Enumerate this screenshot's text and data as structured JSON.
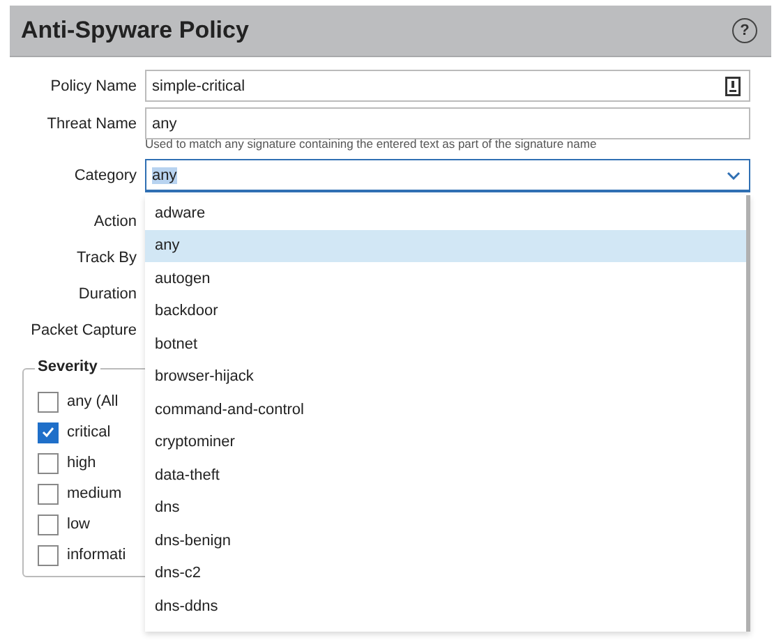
{
  "dialog": {
    "title": "Anti-Spyware Policy",
    "help": "?"
  },
  "fields": [
    {
      "label": "Policy Name",
      "kind": "text",
      "value": "simple-critical"
    },
    {
      "label": "Threat Name",
      "kind": "text",
      "value": "any",
      "hint": "Used to match any signature containing the entered text as part of the signature name"
    },
    {
      "label": "Category",
      "kind": "select",
      "value": "any",
      "focused": true
    }
  ],
  "other_labels": [
    "Action",
    "Track By",
    "Duration",
    "Packet Capture"
  ],
  "severity": {
    "legend": "Severity",
    "options": [
      {
        "label": "any (All",
        "checked": false
      },
      {
        "label": "critical",
        "checked": true
      },
      {
        "label": "high",
        "checked": false
      },
      {
        "label": "medium",
        "checked": false
      },
      {
        "label": "low",
        "checked": false
      },
      {
        "label": "informati",
        "checked": false
      }
    ]
  },
  "dropdown": {
    "items": [
      {
        "label": "adware",
        "selected": false
      },
      {
        "label": "any",
        "selected": true
      },
      {
        "label": "autogen",
        "selected": false
      },
      {
        "label": "backdoor",
        "selected": false
      },
      {
        "label": "botnet",
        "selected": false
      },
      {
        "label": "browser-hijack",
        "selected": false
      },
      {
        "label": "command-and-control",
        "selected": false
      },
      {
        "label": "cryptominer",
        "selected": false
      },
      {
        "label": "data-theft",
        "selected": false
      },
      {
        "label": "dns",
        "selected": false
      },
      {
        "label": "dns-benign",
        "selected": false
      },
      {
        "label": "dns-c2",
        "selected": false
      },
      {
        "label": "dns-ddns",
        "selected": false
      }
    ]
  }
}
